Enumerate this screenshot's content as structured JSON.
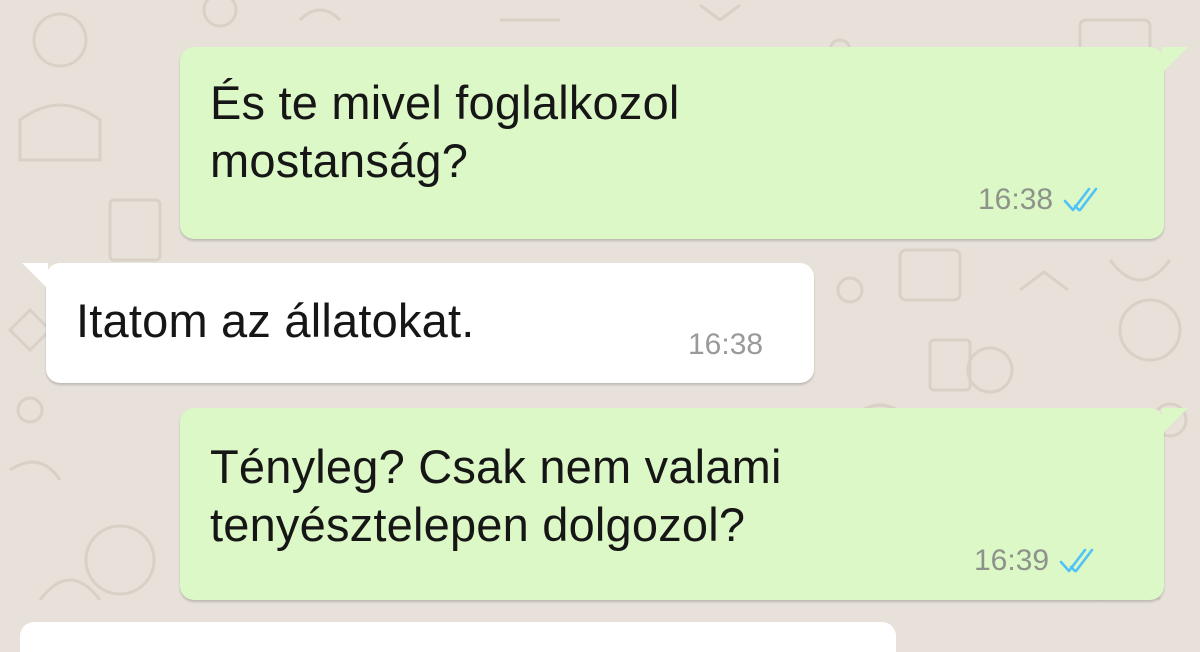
{
  "chat": {
    "messages": [
      {
        "direction": "outgoing",
        "text": "És te mivel foglalkozol\nmostanság?",
        "time": "16:38",
        "status_icon": "double-check-read-icon",
        "status_color": "#4fc3f7"
      },
      {
        "direction": "incoming",
        "text": "Itatom az állatokat.",
        "time": "16:38"
      },
      {
        "direction": "outgoing",
        "text": "Tényleg? Csak nem valami\ntenyésztelepen dolgozol?",
        "time": "16:39",
        "status_icon": "double-check-read-icon",
        "status_color": "#4fc3f7"
      }
    ]
  },
  "colors": {
    "wallpaper": "#e7e1d9",
    "outgoing_bubble": "#dcf8c6",
    "incoming_bubble": "#ffffff",
    "read_receipt": "#4fc3f7"
  }
}
